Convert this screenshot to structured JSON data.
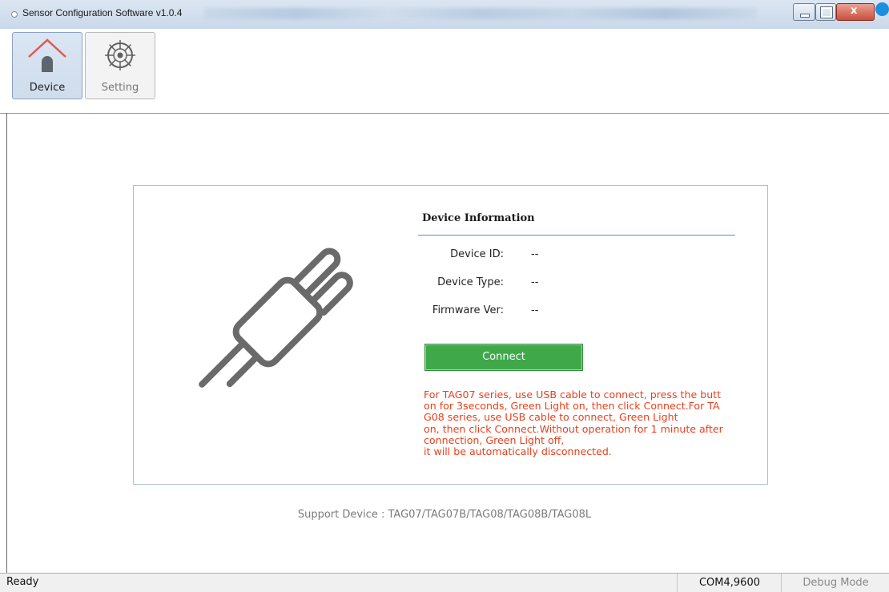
{
  "window": {
    "title": "Sensor Configuration Software v1.0.4"
  },
  "toolbar": {
    "items": [
      {
        "label": "Device",
        "icon": "house-icon",
        "active": true
      },
      {
        "label": "Setting",
        "icon": "gear-icon",
        "active": false
      }
    ]
  },
  "device_info": {
    "title": "Device Information",
    "rows": [
      {
        "label": "Device ID:",
        "value": "--"
      },
      {
        "label": "Device Type:",
        "value": "--"
      },
      {
        "label": "Firmware Ver:",
        "value": "--"
      }
    ],
    "connect_label": "Connect",
    "note_lines": [
      "For TAG07 series, use USB cable to connect, press the butt",
      "on for 3seconds, Green Light on, then click Connect.For TA",
      "G08 series, use USB cable to connect, Green Light",
      "on, then click Connect.Without operation for 1 minute after",
      "connection, Green Light off,",
      "it will be automatically disconnected."
    ],
    "illustration_icon": "plug-icon"
  },
  "support_text": "Support Device : TAG07/TAG07B/TAG08/TAG08B/TAG08L",
  "status": {
    "ready": "Ready",
    "port": "COM4,9600",
    "debug": "Debug Mode"
  },
  "colors": {
    "accent_green": "#3fa94a",
    "note_red": "#e8401c",
    "rule_blue": "#5b8dc9",
    "house_red": "#e25757"
  }
}
